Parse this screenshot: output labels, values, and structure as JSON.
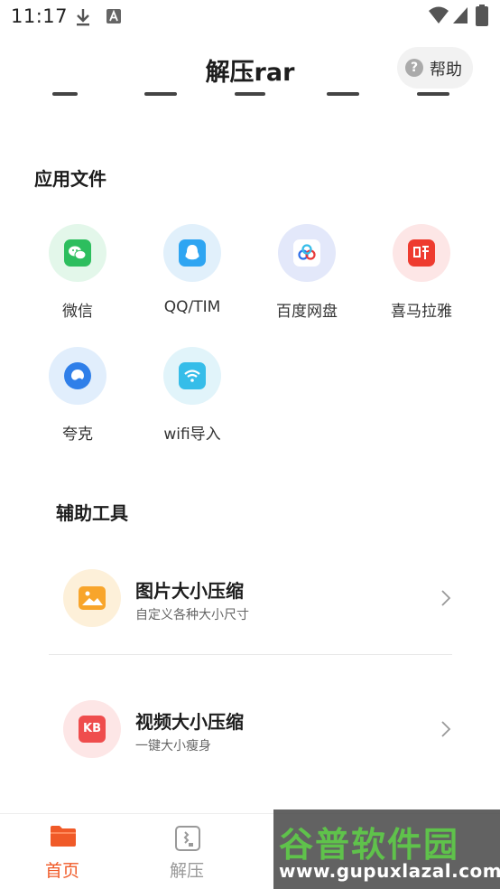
{
  "status_bar": {
    "time": "11:17",
    "icons": [
      "download-icon",
      "a-icon",
      "wifi-icon",
      "signal-icon",
      "battery-icon"
    ]
  },
  "header": {
    "title": "解压rar",
    "help_label": "帮助"
  },
  "app_files": {
    "title": "应用文件",
    "items": [
      {
        "label": "微信",
        "icon": "wechat-icon",
        "bg": "#e3f7ea",
        "fg": "#2dbe5e"
      },
      {
        "label": "QQ/TIM",
        "icon": "qq-icon",
        "bg": "#e1f0fb",
        "fg": "#2ea5f2"
      },
      {
        "label": "百度网盘",
        "icon": "baidu-netdisk-icon",
        "bg": "#e3e8fa",
        "fg": "#ffffff"
      },
      {
        "label": "喜马拉雅",
        "icon": "ximalaya-icon",
        "bg": "#fde6e6",
        "fg": "#ee3b2f"
      },
      {
        "label": "夸克",
        "icon": "quark-icon",
        "bg": "#e1eefc",
        "fg": "#2f7fe9"
      },
      {
        "label": "wifi导入",
        "icon": "wifi-import-icon",
        "bg": "#e1f4fa",
        "fg": "#36bde9"
      }
    ]
  },
  "tools": {
    "title": "辅助工具",
    "items": [
      {
        "title": "图片大小压缩",
        "subtitle": "自定义各种大小尺寸",
        "icon": "image-icon",
        "bg": "#fdf0d9",
        "fg": "#f8a52b"
      },
      {
        "title": "视频大小压缩",
        "subtitle": "一键大小瘦身",
        "icon": "kb-icon",
        "icon_text": "KB",
        "bg": "#fde6e6",
        "fg": "#ef4d4d"
      }
    ]
  },
  "bottom_nav": {
    "items": [
      {
        "label": "首页",
        "icon": "folder-icon",
        "active": true
      },
      {
        "label": "解压",
        "icon": "unzip-icon",
        "active": false
      }
    ],
    "active_color": "#f05a28",
    "inactive_color": "#999999"
  },
  "watermark": {
    "main": "谷普软件园",
    "url": "www.gupuxlazal.com"
  },
  "colors": {
    "accent": "#f05a28"
  }
}
